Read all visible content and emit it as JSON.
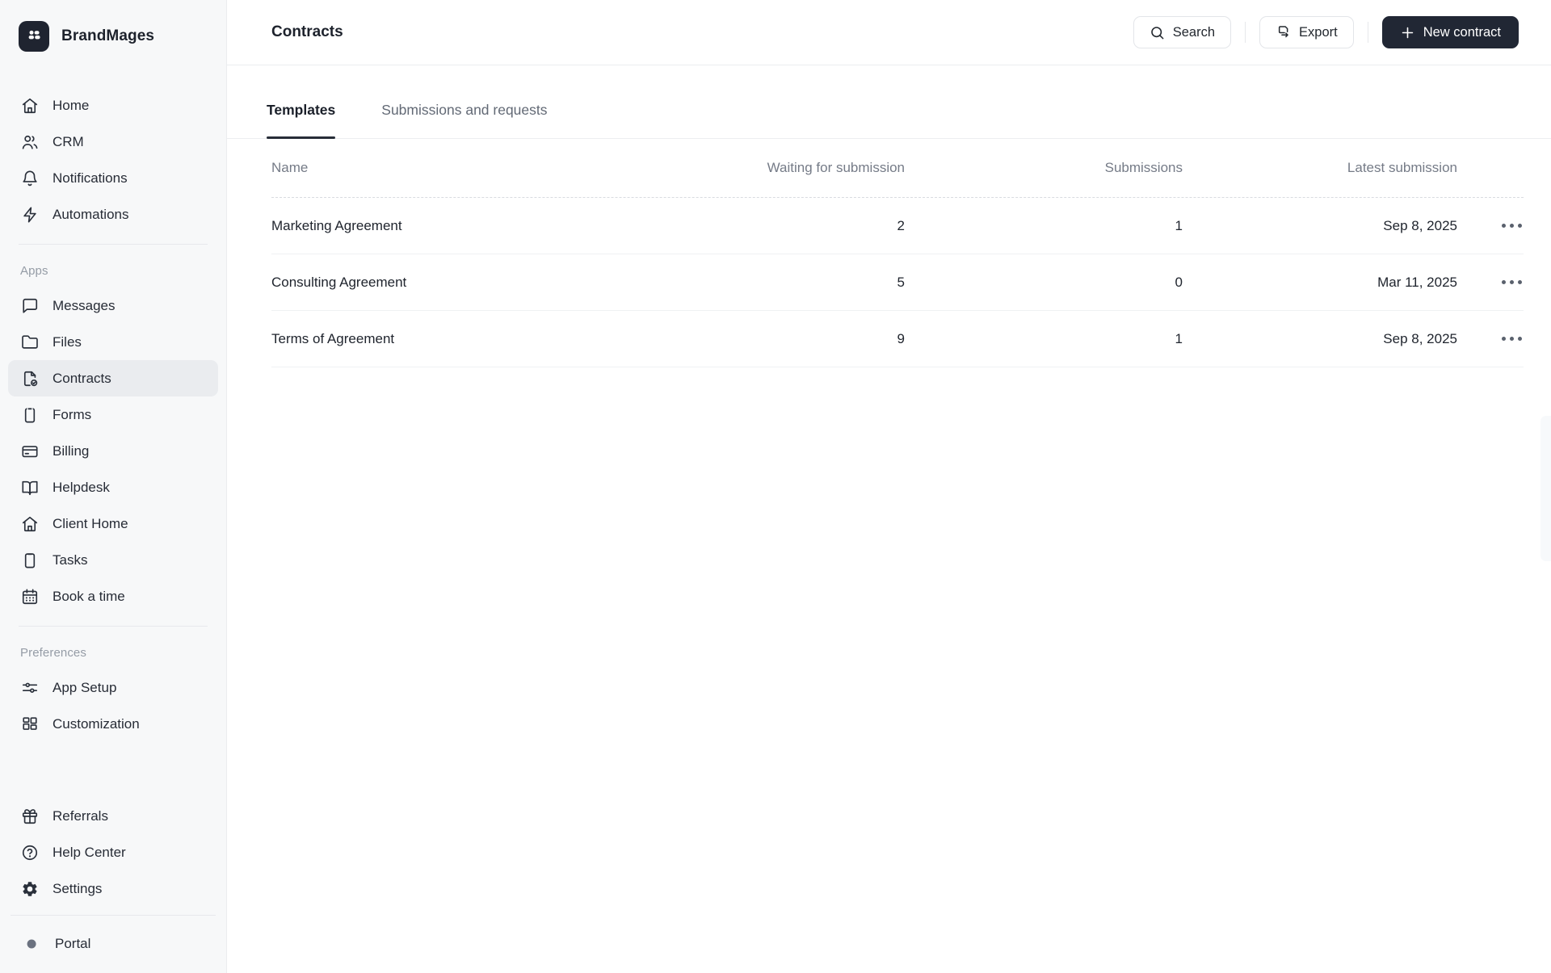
{
  "colors": {
    "accent_dark": "#212734",
    "sidebar_bg": "#f7f8f9",
    "selected_item_bg": "#eaecef",
    "text_primary": "#20252e",
    "text_muted": "#757b87",
    "border": "#eceef0"
  },
  "sidebar": {
    "brand": "BrandMages",
    "brand_icon": "brand-blocks-icon",
    "sections": [
      {
        "items": [
          {
            "label": "Home",
            "icon": "home-icon"
          },
          {
            "label": "CRM",
            "icon": "users-icon"
          },
          {
            "label": "Notifications",
            "icon": "bell-icon"
          },
          {
            "label": "Automations",
            "icon": "zap-icon"
          }
        ]
      },
      {
        "title": "Apps",
        "items": [
          {
            "label": "Messages",
            "icon": "chat-bubble-icon"
          },
          {
            "label": "Files",
            "icon": "folder-icon"
          },
          {
            "label": "Contracts",
            "icon": "contract-check-icon",
            "active": true
          },
          {
            "label": "Forms",
            "icon": "clipboard-icon"
          },
          {
            "label": "Billing",
            "icon": "credit-card-icon"
          },
          {
            "label": "Helpdesk",
            "icon": "open-book-icon"
          },
          {
            "label": "Client Home",
            "icon": "house-icon"
          },
          {
            "label": "Tasks",
            "icon": "task-board-icon"
          },
          {
            "label": "Book a time",
            "icon": "calendar-icon"
          }
        ]
      },
      {
        "title": "Preferences",
        "items": [
          {
            "label": "App Setup",
            "icon": "sliders-icon"
          },
          {
            "label": "Customization",
            "icon": "grid-icon"
          }
        ]
      },
      {
        "items": [
          {
            "label": "Referrals",
            "icon": "gift-icon"
          },
          {
            "label": "Help Center",
            "icon": "help-circle-icon"
          },
          {
            "label": "Settings",
            "icon": "gear-icon"
          }
        ]
      },
      {
        "items": [
          {
            "label": "Portal",
            "icon": "dot-icon"
          }
        ]
      }
    ]
  },
  "header": {
    "title": "Contracts",
    "search_label": "Search",
    "export_label": "Export",
    "new_contract_label": "New contract"
  },
  "tabs": [
    {
      "label": "Templates",
      "active": true
    },
    {
      "label": "Submissions and requests",
      "active": false
    }
  ],
  "table": {
    "columns": [
      "Name",
      "Waiting for submission",
      "Submissions",
      "Latest submission"
    ],
    "rows": [
      {
        "name": "Marketing Agreement",
        "waiting": "2",
        "submissions": "1",
        "latest": "Sep 8, 2025"
      },
      {
        "name": "Consulting Agreement",
        "waiting": "5",
        "submissions": "0",
        "latest": "Mar 11, 2025"
      },
      {
        "name": "Terms of Agreement",
        "waiting": "9",
        "submissions": "1",
        "latest": "Sep 8, 2025"
      }
    ]
  }
}
